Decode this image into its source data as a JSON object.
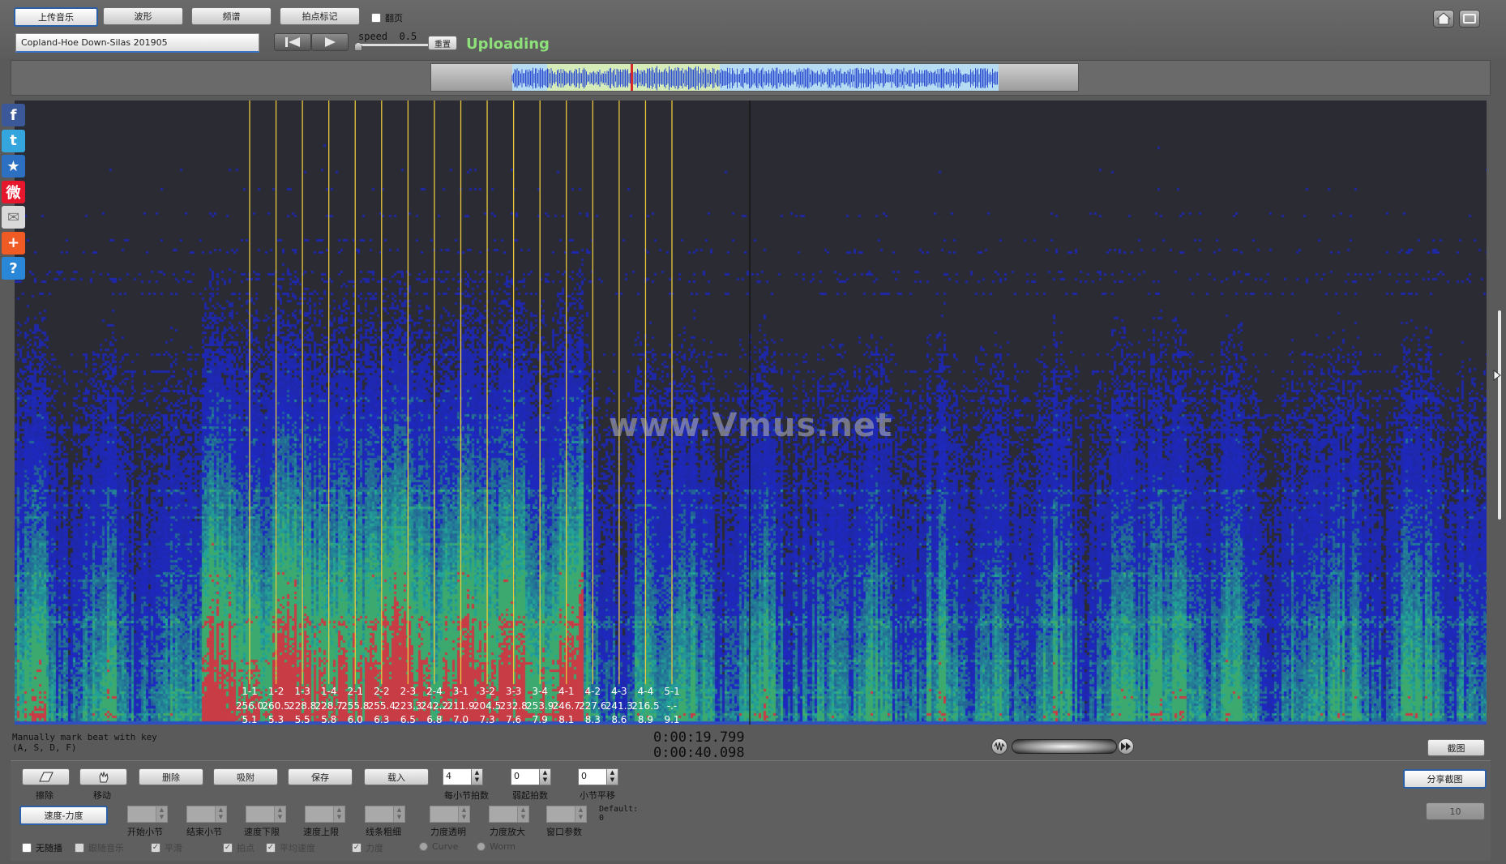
{
  "toolbar": {
    "upload_label": "上传音乐",
    "waveform_label": "波形",
    "spectrum_label": "频谱",
    "beatmark_label": "拍点标记",
    "flip_label": "翻页",
    "song_title": "Copland-Hoe Down-Silas 201905",
    "speed_label": "speed",
    "speed_value": "0.5",
    "reset_label": "重置",
    "status": "Uploading"
  },
  "icons": {
    "home": "home-icon",
    "window": "window-icon",
    "rewind": "skip-back-icon",
    "play": "play-icon",
    "expand": "expand-arrow-icon"
  },
  "social": [
    {
      "name": "facebook-icon",
      "glyph": "f",
      "color": "#3b5998"
    },
    {
      "name": "twitter-icon",
      "glyph": "t",
      "color": "#35a6dd"
    },
    {
      "name": "favorite-star-icon",
      "glyph": "★",
      "color": "#2d6fc0"
    },
    {
      "name": "weibo-icon",
      "glyph": "微",
      "color": "#e6162d"
    },
    {
      "name": "email-icon",
      "glyph": "✉",
      "color": "#d9d9d9"
    },
    {
      "name": "add-share-icon",
      "glyph": "+",
      "color": "#f05a24"
    },
    {
      "name": "help-icon",
      "glyph": "?",
      "color": "#2a86d6"
    }
  ],
  "spectrogram": {
    "watermark": "www.Vmus.net",
    "beats": [
      {
        "label": "1-1",
        "tempo": "256.0",
        "pos": "5.1"
      },
      {
        "label": "1-2",
        "tempo": "260.5",
        "pos": "5.3"
      },
      {
        "label": "1-3",
        "tempo": "228.8",
        "pos": "5.5"
      },
      {
        "label": "1-4",
        "tempo": "228.7",
        "pos": "5.8"
      },
      {
        "label": "2-1",
        "tempo": "255.8",
        "pos": "6.0"
      },
      {
        "label": "2-2",
        "tempo": "255.4",
        "pos": "6.3"
      },
      {
        "label": "2-3",
        "tempo": "223.3",
        "pos": "6.5"
      },
      {
        "label": "2-4",
        "tempo": "242.2",
        "pos": "6.8"
      },
      {
        "label": "3-1",
        "tempo": "211.9",
        "pos": "7.0"
      },
      {
        "label": "3-2",
        "tempo": "204.5",
        "pos": "7.3"
      },
      {
        "label": "3-3",
        "tempo": "232.8",
        "pos": "7.6"
      },
      {
        "label": "3-4",
        "tempo": "253.9",
        "pos": "7.9"
      },
      {
        "label": "4-1",
        "tempo": "246.7",
        "pos": "8.1"
      },
      {
        "label": "4-2",
        "tempo": "227.6",
        "pos": "8.3"
      },
      {
        "label": "4-3",
        "tempo": "241.3",
        "pos": "8.6"
      },
      {
        "label": "4-4",
        "tempo": "216.5",
        "pos": "8.9"
      },
      {
        "label": "5-1",
        "tempo": "-.-",
        "pos": "9.1"
      }
    ]
  },
  "status": {
    "hint_line1": "Manually mark beat with key",
    "hint_line2": "(A, S, D, F)",
    "current_time": "0:00:19.799",
    "total_time": "0:00:40.098",
    "screenshot_label": "截图"
  },
  "panel": {
    "erase_label": "擦除",
    "move_label": "移动",
    "delete_label": "删除",
    "snap_label": "吸附",
    "save_label": "保存",
    "load_label": "载入",
    "beats_per_bar_label": "每小节拍数",
    "beats_per_bar_value": "4",
    "pickup_label": "弱起拍数",
    "pickup_value": "0",
    "bar_offset_label": "小节平移",
    "bar_offset_value": "0",
    "share_label": "分享截图",
    "mode_label": "速度-力度",
    "start_bar_label": "开始小节",
    "end_bar_label": "结束小节",
    "tempo_min_label": "速度下限",
    "tempo_max_label": "速度上限",
    "line_width_label": "线条粗细",
    "opacity_label": "力度透明",
    "dyn_zoom_label": "力度放大",
    "window_param_label": "窗口参数",
    "default_label": "Default:",
    "default_value": "0",
    "side_btn_label": "10",
    "no_follow_label": "无随播",
    "follow_music_label": "跟随音乐",
    "smooth_label": "平滑",
    "beat_label": "拍点",
    "avg_tempo_label": "平均速度",
    "dynamics_label": "力度",
    "curve_label": "Curve",
    "worm_label": "Worm"
  }
}
